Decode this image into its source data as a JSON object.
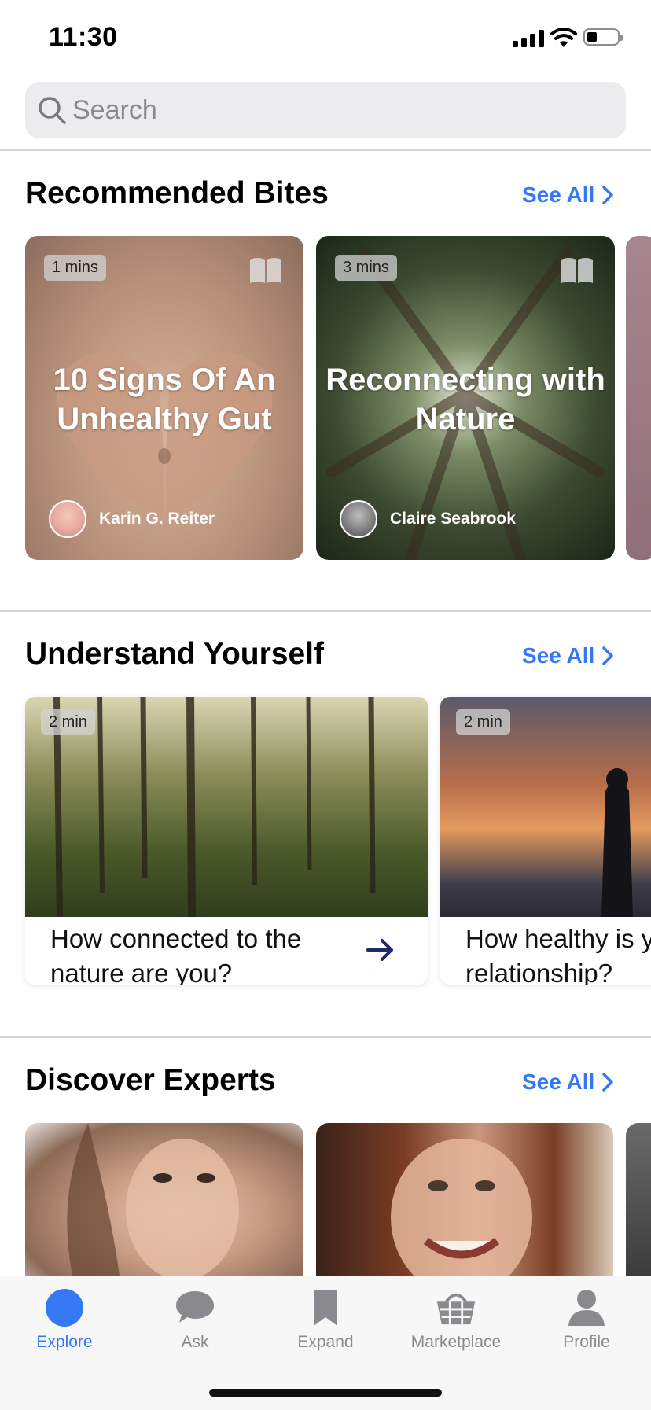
{
  "status": {
    "time": "11:30"
  },
  "search": {
    "placeholder": "Search",
    "value": ""
  },
  "sections": {
    "recommended": {
      "title": "Recommended Bites",
      "see_all": "See All"
    },
    "understand": {
      "title": "Understand Yourself",
      "see_all": "See All"
    },
    "experts": {
      "title": "Discover Experts",
      "see_all": "See All"
    }
  },
  "bites": [
    {
      "duration": "1 mins",
      "title": "10 Signs Of An Unhealthy Gut",
      "author": "Karin G. Reiter"
    },
    {
      "duration": "3 mins",
      "title": "Reconnecting with Nature",
      "author": "Claire Seabrook"
    }
  ],
  "quizzes": [
    {
      "duration": "2 min",
      "question": "How connected to the nature are you?"
    },
    {
      "duration": "2 min",
      "question": "How healthy is y relationship?"
    }
  ],
  "tabs": [
    {
      "label": "Explore",
      "icon": "compass-icon",
      "active": true
    },
    {
      "label": "Ask",
      "icon": "chat-bubble-icon"
    },
    {
      "label": "Expand",
      "icon": "bookmark-icon"
    },
    {
      "label": "Marketplace",
      "icon": "basket-icon"
    },
    {
      "label": "Profile",
      "icon": "person-icon"
    }
  ],
  "colors": {
    "accent": "#3478f6",
    "arrow": "#1f2a6b"
  }
}
